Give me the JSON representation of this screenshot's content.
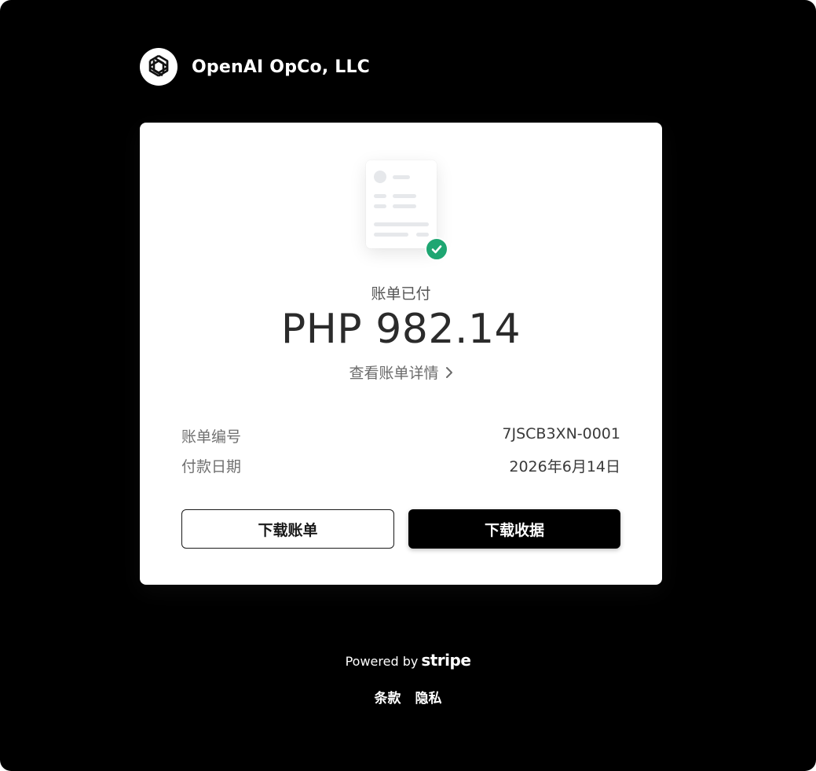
{
  "merchant": {
    "name": "OpenAI OpCo, LLC",
    "logo_icon": "openai-logo-icon"
  },
  "invoice": {
    "status": "账单已付",
    "amount": "PHP 982.14",
    "details_link": "查看账单详情",
    "status_icon": "check-circle-icon",
    "fields": [
      {
        "label": "账单编号",
        "value": "7JSCB3XN-0001"
      },
      {
        "label": "付款日期",
        "value": "2026年6月14日"
      }
    ]
  },
  "actions": {
    "download_invoice": "下载账单",
    "download_receipt": "下载收据"
  },
  "footer": {
    "powered_by": "Powered by",
    "brand": "stripe",
    "terms": "条款",
    "privacy": "隐私"
  },
  "colors": {
    "background": "#000000",
    "card": "#ffffff",
    "success": "#1ea672",
    "primary_button": "#000000"
  }
}
